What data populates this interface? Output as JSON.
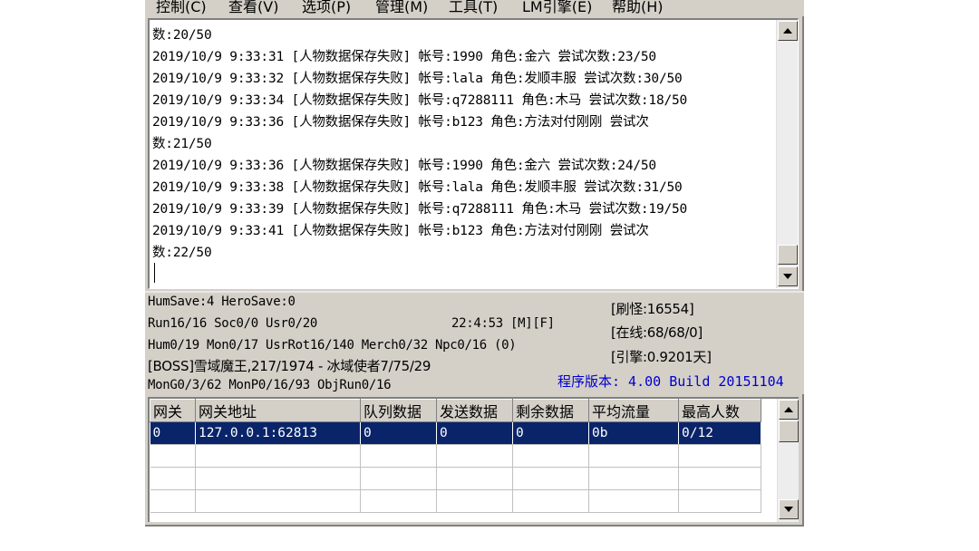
{
  "menu": {
    "items": [
      "控制(C)",
      "查看(V)",
      "选项(P)",
      "管理(M)",
      "工具(T)",
      "LM引擎(E)",
      "帮助(H)"
    ]
  },
  "log": {
    "lines": [
      "数:20/50",
      "2019/10/9 9:33:31 [人物数据保存失败] 帐号:1990 角色:金六 尝试次数:23/50",
      "2019/10/9 9:33:32 [人物数据保存失败] 帐号:lala 角色:发顺丰服 尝试次数:30/50",
      "2019/10/9 9:33:34 [人物数据保存失败] 帐号:q7288111 角色:木马 尝试次数:18/50",
      "2019/10/9 9:33:36 [人物数据保存失败] 帐号:b123 角色:方法对付刚刚 尝试次",
      "数:21/50",
      "2019/10/9 9:33:36 [人物数据保存失败] 帐号:1990 角色:金六 尝试次数:24/50",
      "2019/10/9 9:33:38 [人物数据保存失败] 帐号:lala 角色:发顺丰服 尝试次数:31/50",
      "2019/10/9 9:33:39 [人物数据保存失败] 帐号:q7288111 角色:木马 尝试次数:19/50",
      "2019/10/9 9:33:41 [人物数据保存失败] 帐号:b123 角色:方法对付刚刚 尝试次",
      "数:22/50"
    ]
  },
  "status": {
    "hum_save": "HumSave:4 HeroSave:0",
    "run": "Run16/16 Soc0/0 Usr0/20",
    "time": "22:4:53 [M][F]",
    "hum": "Hum0/19 Mon0/17 UsrRot16/140 Merch0/32 Npc0/16 (0)",
    "boss": "[BOSS]雪域魔王,217/1974 - 冰域使者7/75/29",
    "mongo": "MonG0/3/62 MonP0/16/93 ObjRun0/16",
    "refresh": "[刷怪:16554]",
    "online": "[在线:68/68/0]",
    "engine": "[引擎:0.9201天]",
    "version": "程序版本: 4.00 Build 20151104"
  },
  "gateway_table": {
    "columns": [
      "网关",
      "网关地址",
      "队列数据",
      "发送数据",
      "剩余数据",
      "平均流量",
      "最高人数"
    ],
    "rows": [
      [
        "0",
        "127.0.0.1:62813",
        "0",
        "0",
        "0",
        "0b",
        "0/12"
      ]
    ]
  },
  "colors": {
    "window_bg": "#d4d0c8",
    "selection": "#0a246a",
    "version_text": "#0000cc"
  }
}
